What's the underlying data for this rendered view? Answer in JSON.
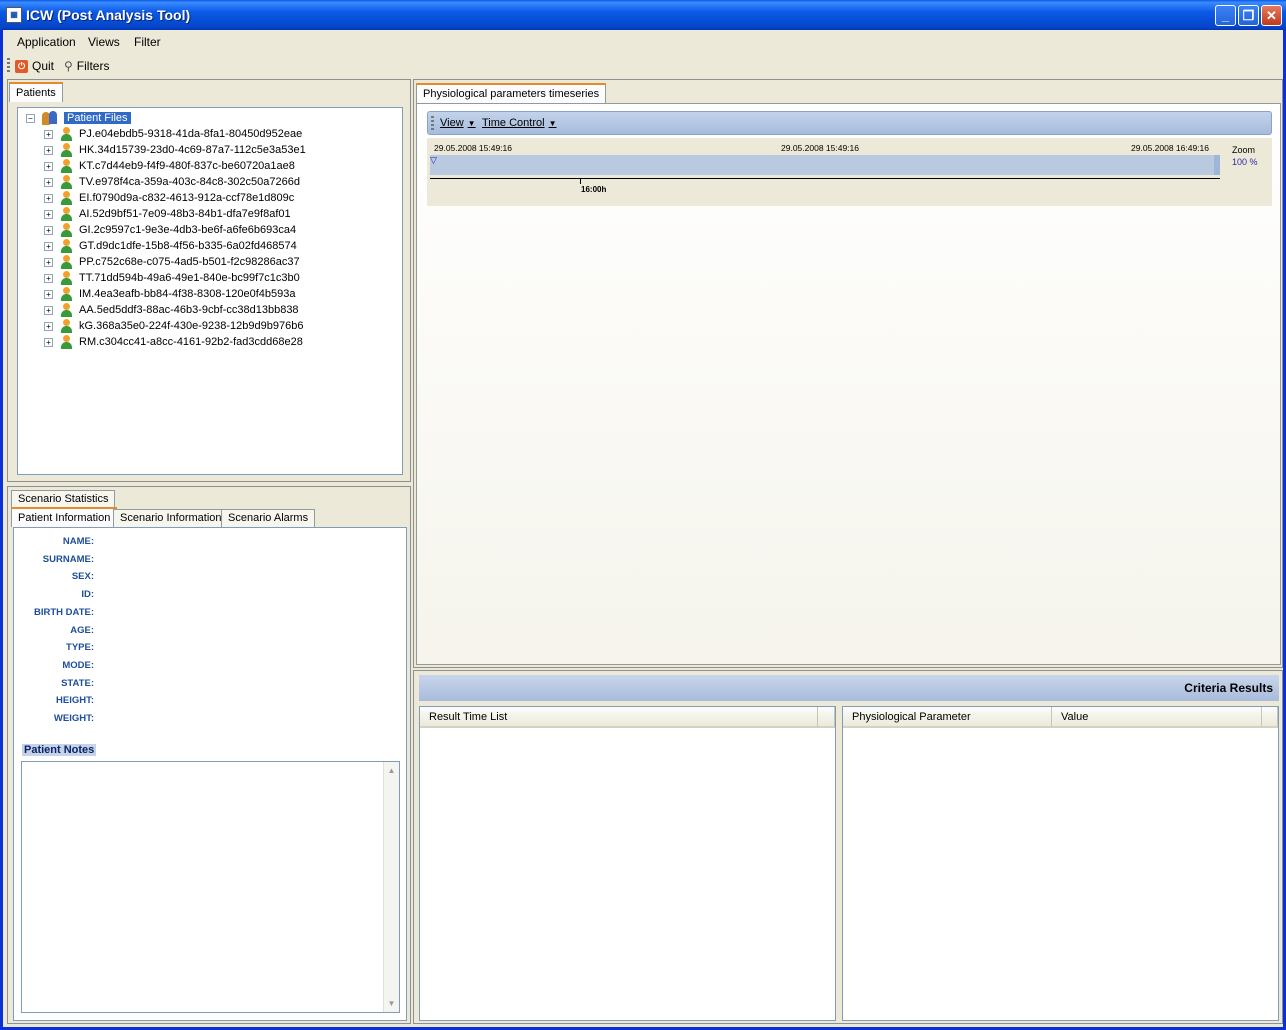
{
  "window": {
    "title": "ICW (Post Analysis Tool)",
    "app_icon": "app-icon",
    "buttons": [
      "minimize-icon",
      "restore-icon",
      "close-icon"
    ]
  },
  "menubar": {
    "items": [
      "Application",
      "Views",
      "Filter"
    ]
  },
  "toolbar": {
    "quit_label": "Quit",
    "filters_label": "Filters"
  },
  "patients_panel": {
    "tab": "Patients",
    "root": "Patient Files",
    "patients": [
      "PJ.e04ebdb5-9318-41da-8fa1-80450d952eae",
      "HK.34d15739-23d0-4c69-87a7-112c5e3a53e1",
      "KT.c7d44eb9-f4f9-480f-837c-be60720a1ae8",
      "TV.e978f4ca-359a-403c-84c8-302c50a7266d",
      "EI.f0790d9a-c832-4613-912a-ccf78e1d809c",
      "AI.52d9bf51-7e09-48b3-84b1-dfa7e9f8af01",
      "GI.2c9597c1-9e3e-4db3-be6f-a6fe6b693ca4",
      "GT.d9dc1dfe-15b8-4f56-b335-6a02fd468574",
      "PP.c752c68e-c075-4ad5-b501-f2c98286ac37",
      "TT.71dd594b-49a6-49e1-840e-bc99f7c1c3b0",
      "IM.4ea3eafb-bb84-4f38-8308-120e0f4b593a",
      "AA.5ed5ddf3-88ac-46b3-9cbf-cc38d13bb838",
      "kG.368a35e0-224f-430e-9238-12b9d9b976b6",
      "RM.c304cc41-a8cc-4161-92b2-fad3cdd68e28"
    ]
  },
  "info_panel": {
    "tabs_row1": [
      "Scenario Statistics"
    ],
    "tabs_row2": [
      "Patient Information",
      "Scenario Information",
      "Scenario Alarms"
    ],
    "fields": [
      "NAME:",
      "SURNAME:",
      "SEX:",
      "ID:",
      "BIRTH DATE:",
      "AGE:",
      "TYPE:",
      "MODE:",
      "STATE:",
      "HEIGHT:",
      "WEIGHT:"
    ],
    "notes_title": "Patient Notes"
  },
  "timeseries": {
    "tab": "Physiological parameters timeseries",
    "menu": [
      "View",
      "Time Control"
    ],
    "start": "29.05.2008 15:49:16",
    "middle": "29.05.2008 15:49:16",
    "end": "29.05.2008 16:49:16",
    "tick_label": "16:00h",
    "zoom_label": "Zoom",
    "zoom_value": "100 %"
  },
  "criteria": {
    "title": "Criteria Results",
    "left_columns": [
      "Result Time List"
    ],
    "right_columns": [
      "Physiological Parameter",
      "Value"
    ]
  },
  "colors": {
    "title_bar": "#0a58e7",
    "selection": "#316ac5",
    "header_band": "#b8c9e0",
    "tab_accent": "#e68b2c"
  }
}
